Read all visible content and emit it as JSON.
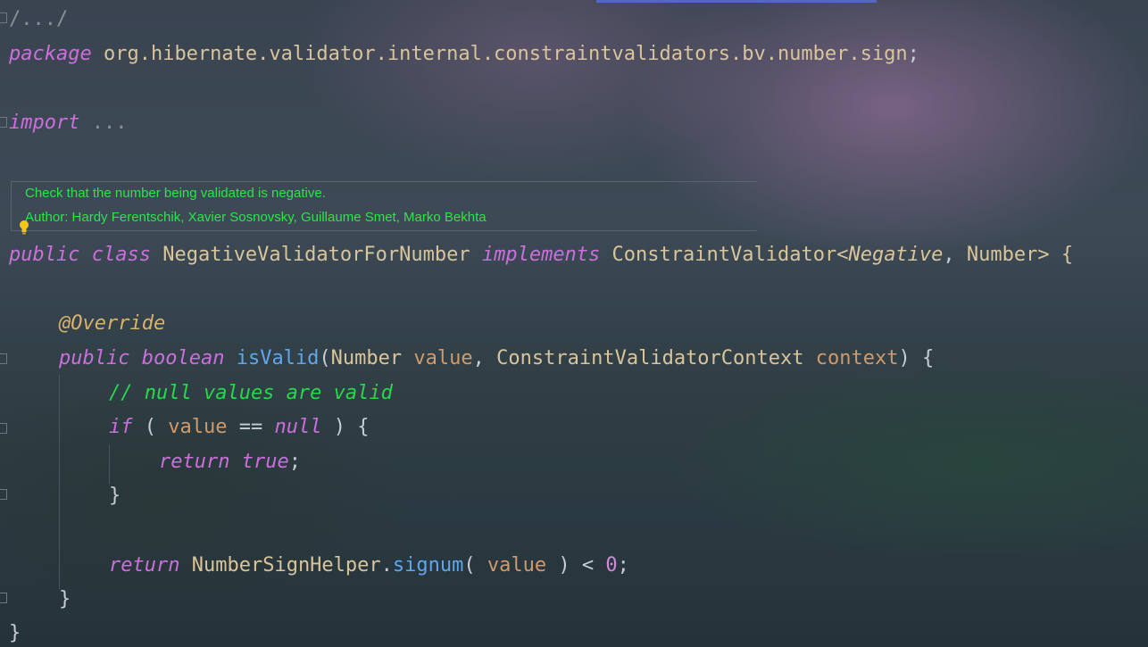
{
  "editor": {
    "header_fold": "/.../",
    "package_kw": "package",
    "package_name": "org.hibernate.validator.internal.constraintvalidators.bv.number.sign",
    "semicolon": ";",
    "import_kw": "import",
    "import_ellipsis": "...",
    "doc": {
      "line1": "Check that the number being validated is negative.",
      "line2": "Author: Hardy Ferentschik, Xavier Sosnovsky, Guillaume Smet, Marko Bekhta"
    },
    "class_line": {
      "public": "public",
      "class": "class",
      "name": "NegativeValidatorForNumber",
      "implements": "implements",
      "iface": "ConstraintValidator<",
      "type1": "Negative",
      "sep": ", ",
      "type2": "Number> {"
    },
    "override": "@Override",
    "method_line": {
      "public": "public",
      "boolean": "boolean",
      "name": "isValid",
      "open": "(",
      "t1": "Number",
      "p1": "value",
      "comma": ", ",
      "t2": "ConstraintValidatorContext",
      "p2": "context",
      "close": ") {"
    },
    "comment": "// null values are valid",
    "if_line": {
      "if": "if",
      "open": " ( ",
      "value": "value",
      "op": " == ",
      "null": "null",
      "close": " ) {"
    },
    "return_true": {
      "return": "return",
      "true": "true",
      "semi": ";"
    },
    "close_brace": "}",
    "return_line": {
      "return": "return",
      "cls": "NumberSignHelper",
      "dot": ".",
      "fn": "signum",
      "open": "( ",
      "value": "value",
      "rest": " ) < ",
      "zero": "0",
      "semi": ";"
    },
    "method_close": "}",
    "class_close": "}"
  },
  "colors": {
    "keyword": "#cc6fdc",
    "comment": "#27d94a",
    "annotation": "#d9b26b",
    "function": "#5fa7ea",
    "parameter": "#d09a6a",
    "doc_text": "#2ee34a"
  }
}
